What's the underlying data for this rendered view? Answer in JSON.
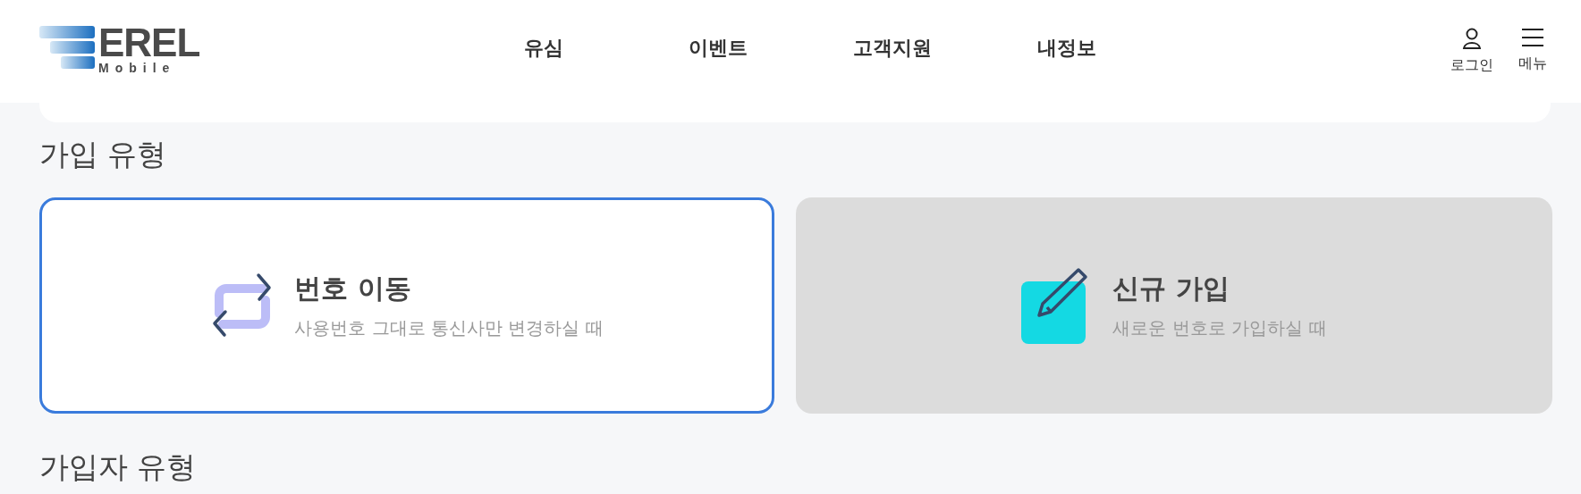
{
  "logo": {
    "wordmark": "EREL",
    "sub": "Mobile"
  },
  "nav": [
    "유심",
    "이벤트",
    "고객지원",
    "내정보"
  ],
  "actions": [
    {
      "kind": "user",
      "label": "로그인"
    },
    {
      "kind": "menu",
      "label": "메뉴"
    }
  ],
  "section_title": "가입 유형",
  "options": [
    {
      "kind": "transfer",
      "title": "번호 이동",
      "desc": "사용번호 그대로 통신사만 변경하실 때",
      "selected": true
    },
    {
      "kind": "new",
      "title": "신규 가입",
      "desc": "새로운 번호로 가입하실 때",
      "selected": false
    }
  ],
  "next_section_title": "가입자 유형"
}
